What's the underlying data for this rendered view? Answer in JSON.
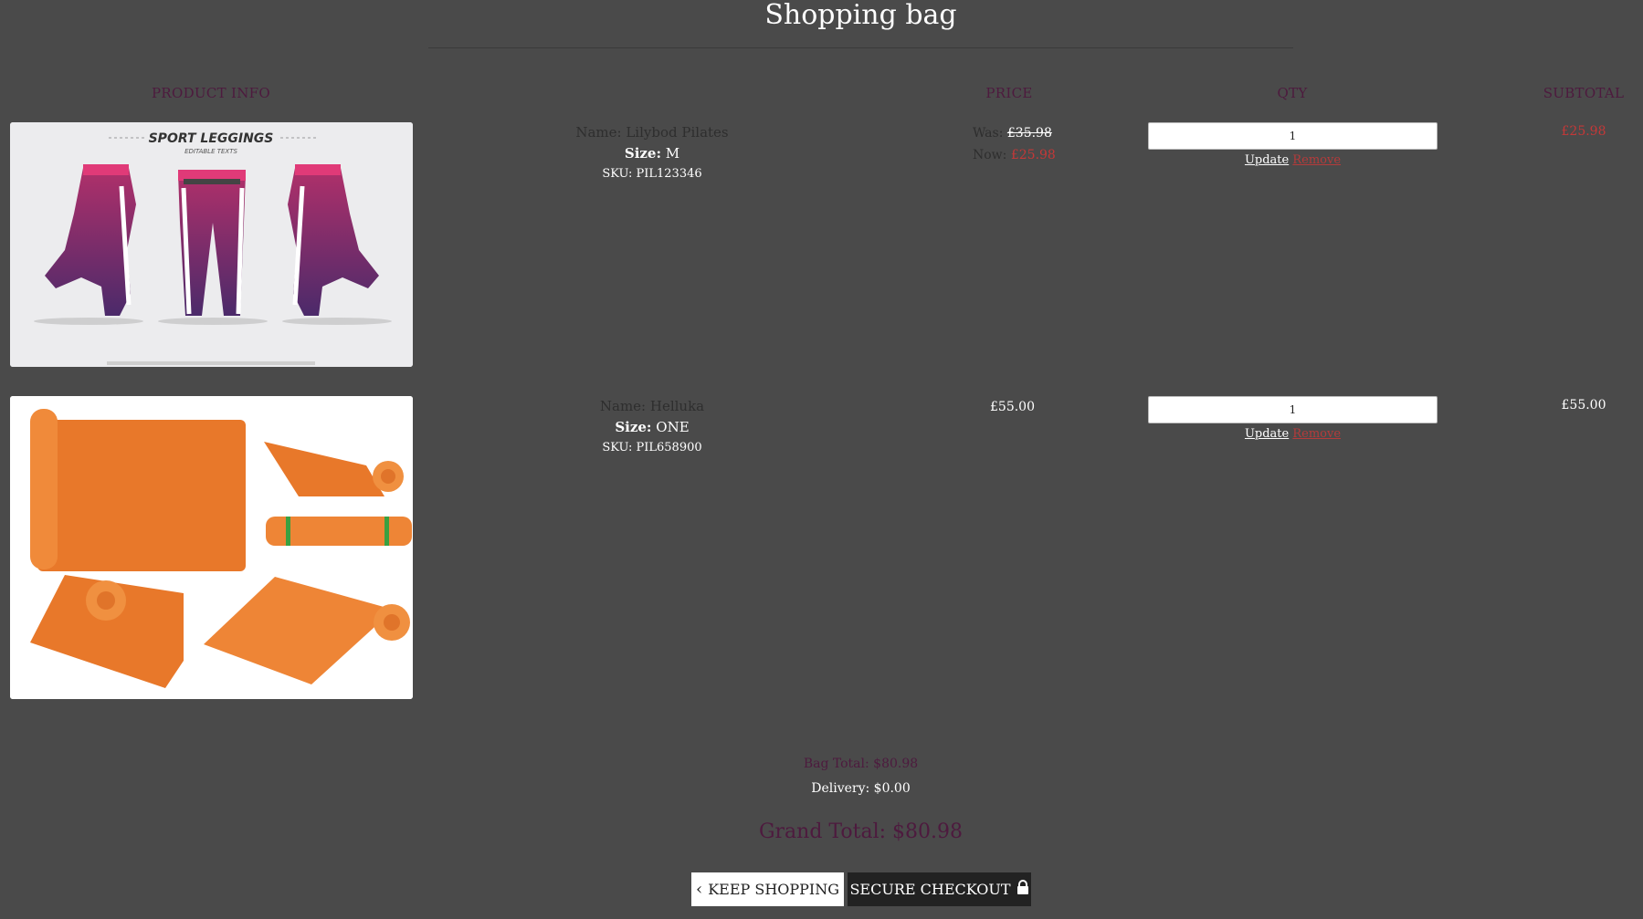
{
  "page": {
    "title": "Shopping bag"
  },
  "columns": {
    "product_info": "PRODUCT INFO",
    "price": "PRICE",
    "qty": "QTY",
    "subtotal": "SUBTOTAL"
  },
  "items": [
    {
      "name": "Name: Lilybod Pilates",
      "size_label": "Size:",
      "size_value": "M",
      "sku": "SKU: PIL123346",
      "price_was_label": "Was:",
      "price_was": "£35.98",
      "price_now_label": "Now:",
      "price_now": "£25.98",
      "qty": "1",
      "update_label": "Update",
      "remove_label": "Remove",
      "subtotal": "£25.98",
      "image_heading": "SPORT LEGGINGS",
      "image_subheading": "EDITABLE TEXTS"
    },
    {
      "name": "Name: Helluka",
      "size_label": "Size:",
      "size_value": "ONE",
      "sku": "SKU: PIL658900",
      "price": "£55.00",
      "qty": "1",
      "update_label": "Update",
      "remove_label": "Remove",
      "subtotal": "£55.00"
    }
  ],
  "summary": {
    "bag_total": "Bag Total: $80.98",
    "delivery": "Delivery: $0.00",
    "grand_total": "Grand Total: $80.98"
  },
  "actions": {
    "keep_shopping": "KEEP SHOPPING",
    "secure_checkout": "SECURE CHECKOUT"
  },
  "colors": {
    "background": "#4a4a4a",
    "accent_purple": "#4d1a3e",
    "sale_red": "#c43838",
    "checkout_bg": "#222222"
  }
}
